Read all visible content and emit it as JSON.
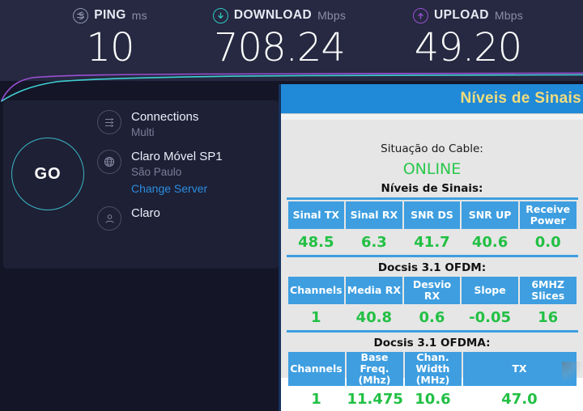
{
  "speedtest": {
    "metrics": [
      {
        "id": "ping",
        "icon": "ping-icon",
        "label": "PING",
        "unit": "ms",
        "value": "10",
        "color": "#8d93b0"
      },
      {
        "id": "download",
        "icon": "download-icon",
        "label": "DOWNLOAD",
        "unit": "Mbps",
        "value": "708.24",
        "color": "#2ec8c0"
      },
      {
        "id": "upload",
        "icon": "upload-icon",
        "label": "UPLOAD",
        "unit": "Mbps",
        "value": "49.20",
        "color": "#9b4fd4"
      }
    ],
    "go_button": "GO",
    "info": [
      {
        "icon": "connections-icon",
        "title": "Connections",
        "sub": "Multi",
        "link": ""
      },
      {
        "icon": "globe-icon",
        "title": "Claro Móvel SP1",
        "sub": "São Paulo",
        "link": "Change Server"
      },
      {
        "icon": "person-icon",
        "title": "Claro",
        "sub": "",
        "link": ""
      }
    ],
    "graph": {
      "download_curve_color": "#3fd0d4",
      "upload_curve_color": "#9b4fd4"
    }
  },
  "modem": {
    "title": "Níveis de Sinais",
    "title_color": "#f2dd7c",
    "header_bg": "#2089d8",
    "cable_status_label": "Situação do Cable:",
    "cable_status_value": "ONLINE",
    "cable_status_color": "#28c84b",
    "signal_caption": "Níveis de Sinais:",
    "ofdm_caption": "Docsis 3.1 OFDM:",
    "ofdma_caption": "Docsis 3.1 OFDMA:",
    "tables": [
      {
        "id": "signal-levels-table",
        "headers": [
          "Sinal TX",
          "Sinal RX",
          "SNR DS",
          "SNR UP",
          "Receive Power"
        ],
        "values": [
          "48.5",
          "6.3",
          "41.7",
          "40.6",
          "0.0"
        ],
        "widths": [
          "20%",
          "20%",
          "20%",
          "20%",
          "20%"
        ]
      },
      {
        "id": "ofdm-table",
        "headers": [
          "Channels",
          "Media RX",
          "Desvio RX",
          "Slope",
          "6MHZ Slices"
        ],
        "values": [
          "1",
          "40.8",
          "0.6",
          "-0.05",
          "16"
        ],
        "widths": [
          "20%",
          "20%",
          "20%",
          "20%",
          "20%"
        ]
      },
      {
        "id": "ofdma-table",
        "headers": [
          "Channels",
          "Base Freq. (Mhz)",
          "Chan. Width (MHz)",
          "TX"
        ],
        "values": [
          "1",
          "11.475",
          "10.6",
          "47.0"
        ],
        "widths": [
          "20%",
          "20%",
          "20%",
          "40%"
        ]
      }
    ]
  }
}
